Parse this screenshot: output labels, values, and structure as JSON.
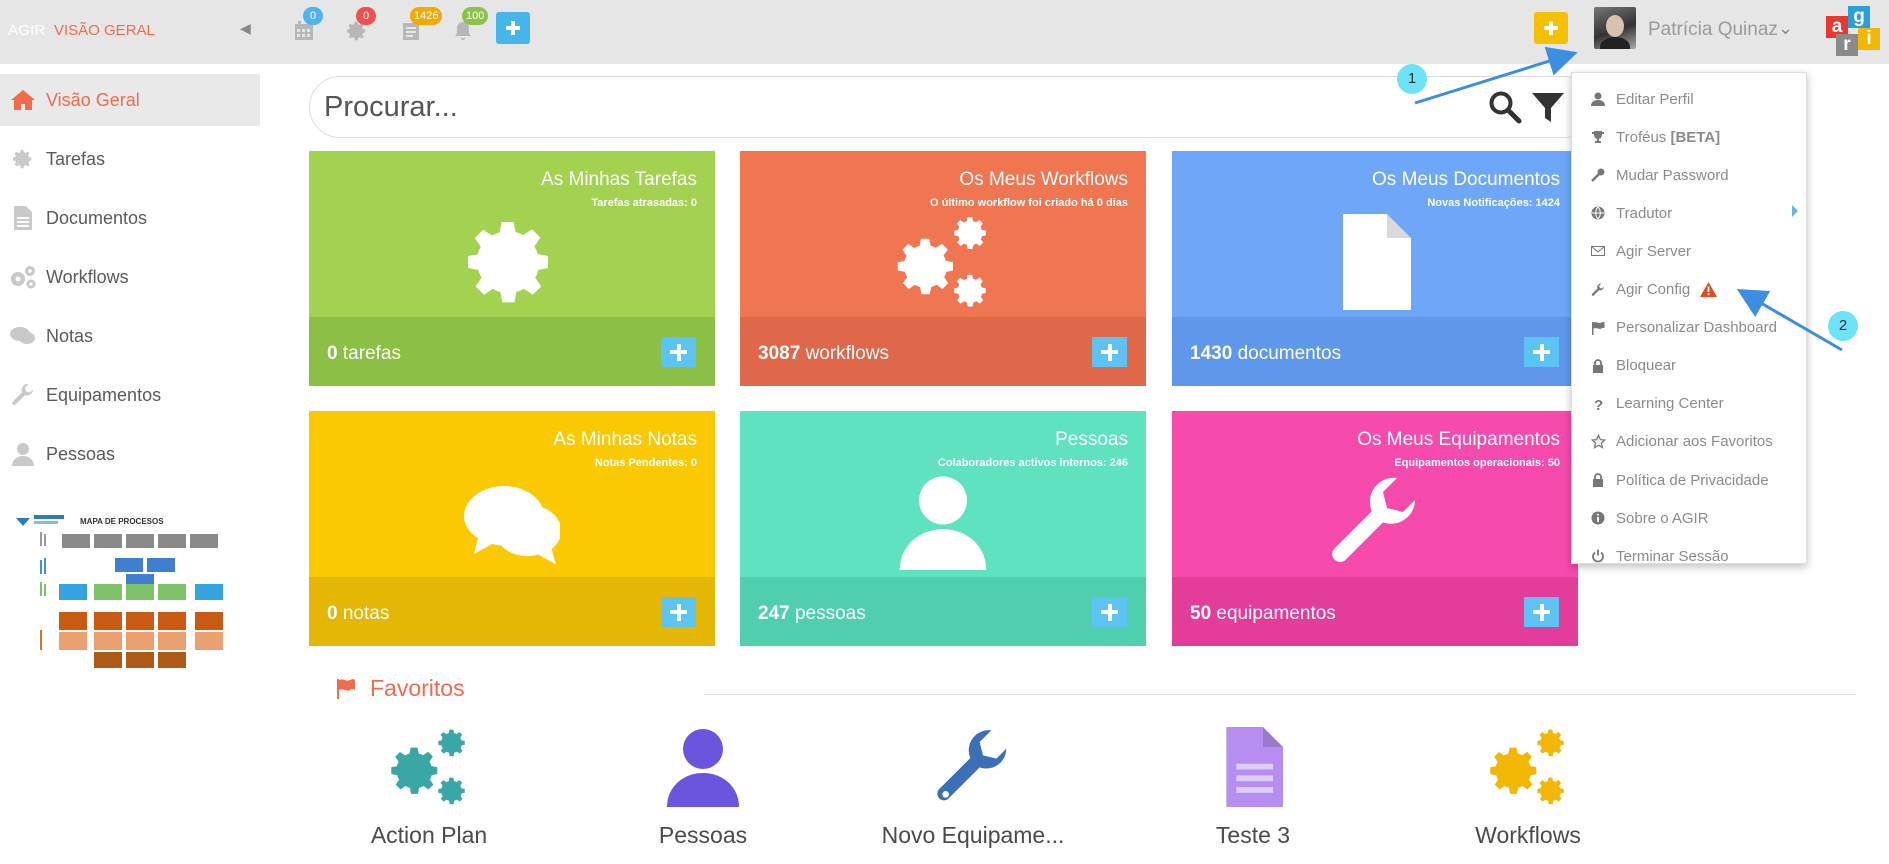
{
  "header": {
    "brand": "AGIR",
    "breadcrumb": "VISÃO GERAL",
    "badges": {
      "calendar": "0",
      "settings": "0",
      "documents": "1426",
      "notifications": "100"
    },
    "user_name": "Patrícia Quinaz",
    "logo_letters": [
      "a",
      "g",
      "r",
      "i"
    ]
  },
  "sidebar": {
    "items": [
      {
        "label": "Visão Geral",
        "icon": "home-icon",
        "active": true
      },
      {
        "label": "Tarefas",
        "icon": "gear-icon"
      },
      {
        "label": "Documentos",
        "icon": "document-icon"
      },
      {
        "label": "Workflows",
        "icon": "gears-icon"
      },
      {
        "label": "Notas",
        "icon": "chat-icon"
      },
      {
        "label": "Equipamentos",
        "icon": "wrench-icon"
      },
      {
        "label": "Pessoas",
        "icon": "user-icon"
      }
    ],
    "process_map_title": "MAPA DE PROCESOS"
  },
  "search": {
    "placeholder": "Procurar..."
  },
  "tiles": [
    {
      "title": "As Minhas Tarefas",
      "subtitle": "Tarefas atrasadas: 0",
      "count": "0",
      "unit": "tarefas",
      "color": "#a2d250",
      "foot_color": "#8cbf45",
      "icon": "gear-icon"
    },
    {
      "title": "Os Meus Workflows",
      "subtitle": "O último workflow foi criado há 0 dias",
      "count": "3087",
      "unit": "workflows",
      "color": "#f07651",
      "foot_color": "#de6849",
      "icon": "gears-icon"
    },
    {
      "title": "Os Meus Documentos",
      "subtitle": "Novas Notificações: 1424",
      "count": "1430",
      "unit": "documentos",
      "color": "#6ea7f7",
      "foot_color": "#5f97ea",
      "icon": "document-icon"
    },
    {
      "title": "As Minhas Notas",
      "subtitle": "Notas Pendentes: 0",
      "count": "0",
      "unit": "notas",
      "color": "#fac902",
      "foot_color": "#e4b704",
      "icon": "chat-icon"
    },
    {
      "title": "Pessoas",
      "subtitle": "Colaboradores activos internos: 246",
      "count": "247",
      "unit": "pessoas",
      "color": "#5ee2c0",
      "foot_color": "#50cfae",
      "icon": "user-icon"
    },
    {
      "title": "Os Meus Equipamentos",
      "subtitle": "Equipamentos operacionais: 50",
      "count": "50",
      "unit": "equipamentos",
      "color": "#f64aad",
      "foot_color": "#e23d9b",
      "icon": "wrench-icon"
    }
  ],
  "favorites": {
    "title": "Favoritos",
    "items": [
      {
        "label": "Action Plan",
        "icon": "gears-icon",
        "color": "#3aa6a6"
      },
      {
        "label": "Pessoas",
        "icon": "user-icon",
        "color": "#6b55dc"
      },
      {
        "label": "Novo Equipame...",
        "icon": "wrench-icon",
        "color": "#3c6fb5"
      },
      {
        "label": "Teste 3",
        "icon": "document-icon",
        "color": "#b78ef0"
      },
      {
        "label": "Workflows",
        "icon": "gears-icon",
        "color": "#f2b705"
      }
    ]
  },
  "user_menu": {
    "items": [
      {
        "label": "Editar Perfil",
        "icon": "user-icon"
      },
      {
        "label": "Troféus ",
        "bold": "[BETA]",
        "icon": "trophy-icon"
      },
      {
        "label": "Mudar Password",
        "icon": "key-icon"
      },
      {
        "label": "Tradutor",
        "icon": "globe-icon",
        "submenu": true
      },
      {
        "label": "Agir Server",
        "icon": "envelope-icon"
      },
      {
        "label": "Agir Config",
        "icon": "wrench-icon",
        "warning": true
      },
      {
        "label": "Personalizar Dashboard",
        "icon": "flag-icon"
      },
      {
        "label": "Bloquear",
        "icon": "lock-icon"
      },
      {
        "label": "Learning Center",
        "icon": "question-icon"
      },
      {
        "label": "Adicionar aos Favoritos",
        "icon": "star-icon"
      },
      {
        "label": "Política de Privacidade",
        "icon": "lock-icon"
      },
      {
        "label": "Sobre o AGIR",
        "icon": "info-icon"
      },
      {
        "label": "Terminar Sessão",
        "icon": "power-icon"
      }
    ]
  },
  "annotations": [
    "1",
    "2"
  ],
  "colors": {
    "accent": "#f26b4a",
    "tile_add": "#5cc3f2",
    "top_add_blue": "#45b5ea",
    "top_add_yellow": "#f6c000",
    "annotation_arrow": "#3c8fe0",
    "annotation_bubble": "#6ee3f7"
  }
}
